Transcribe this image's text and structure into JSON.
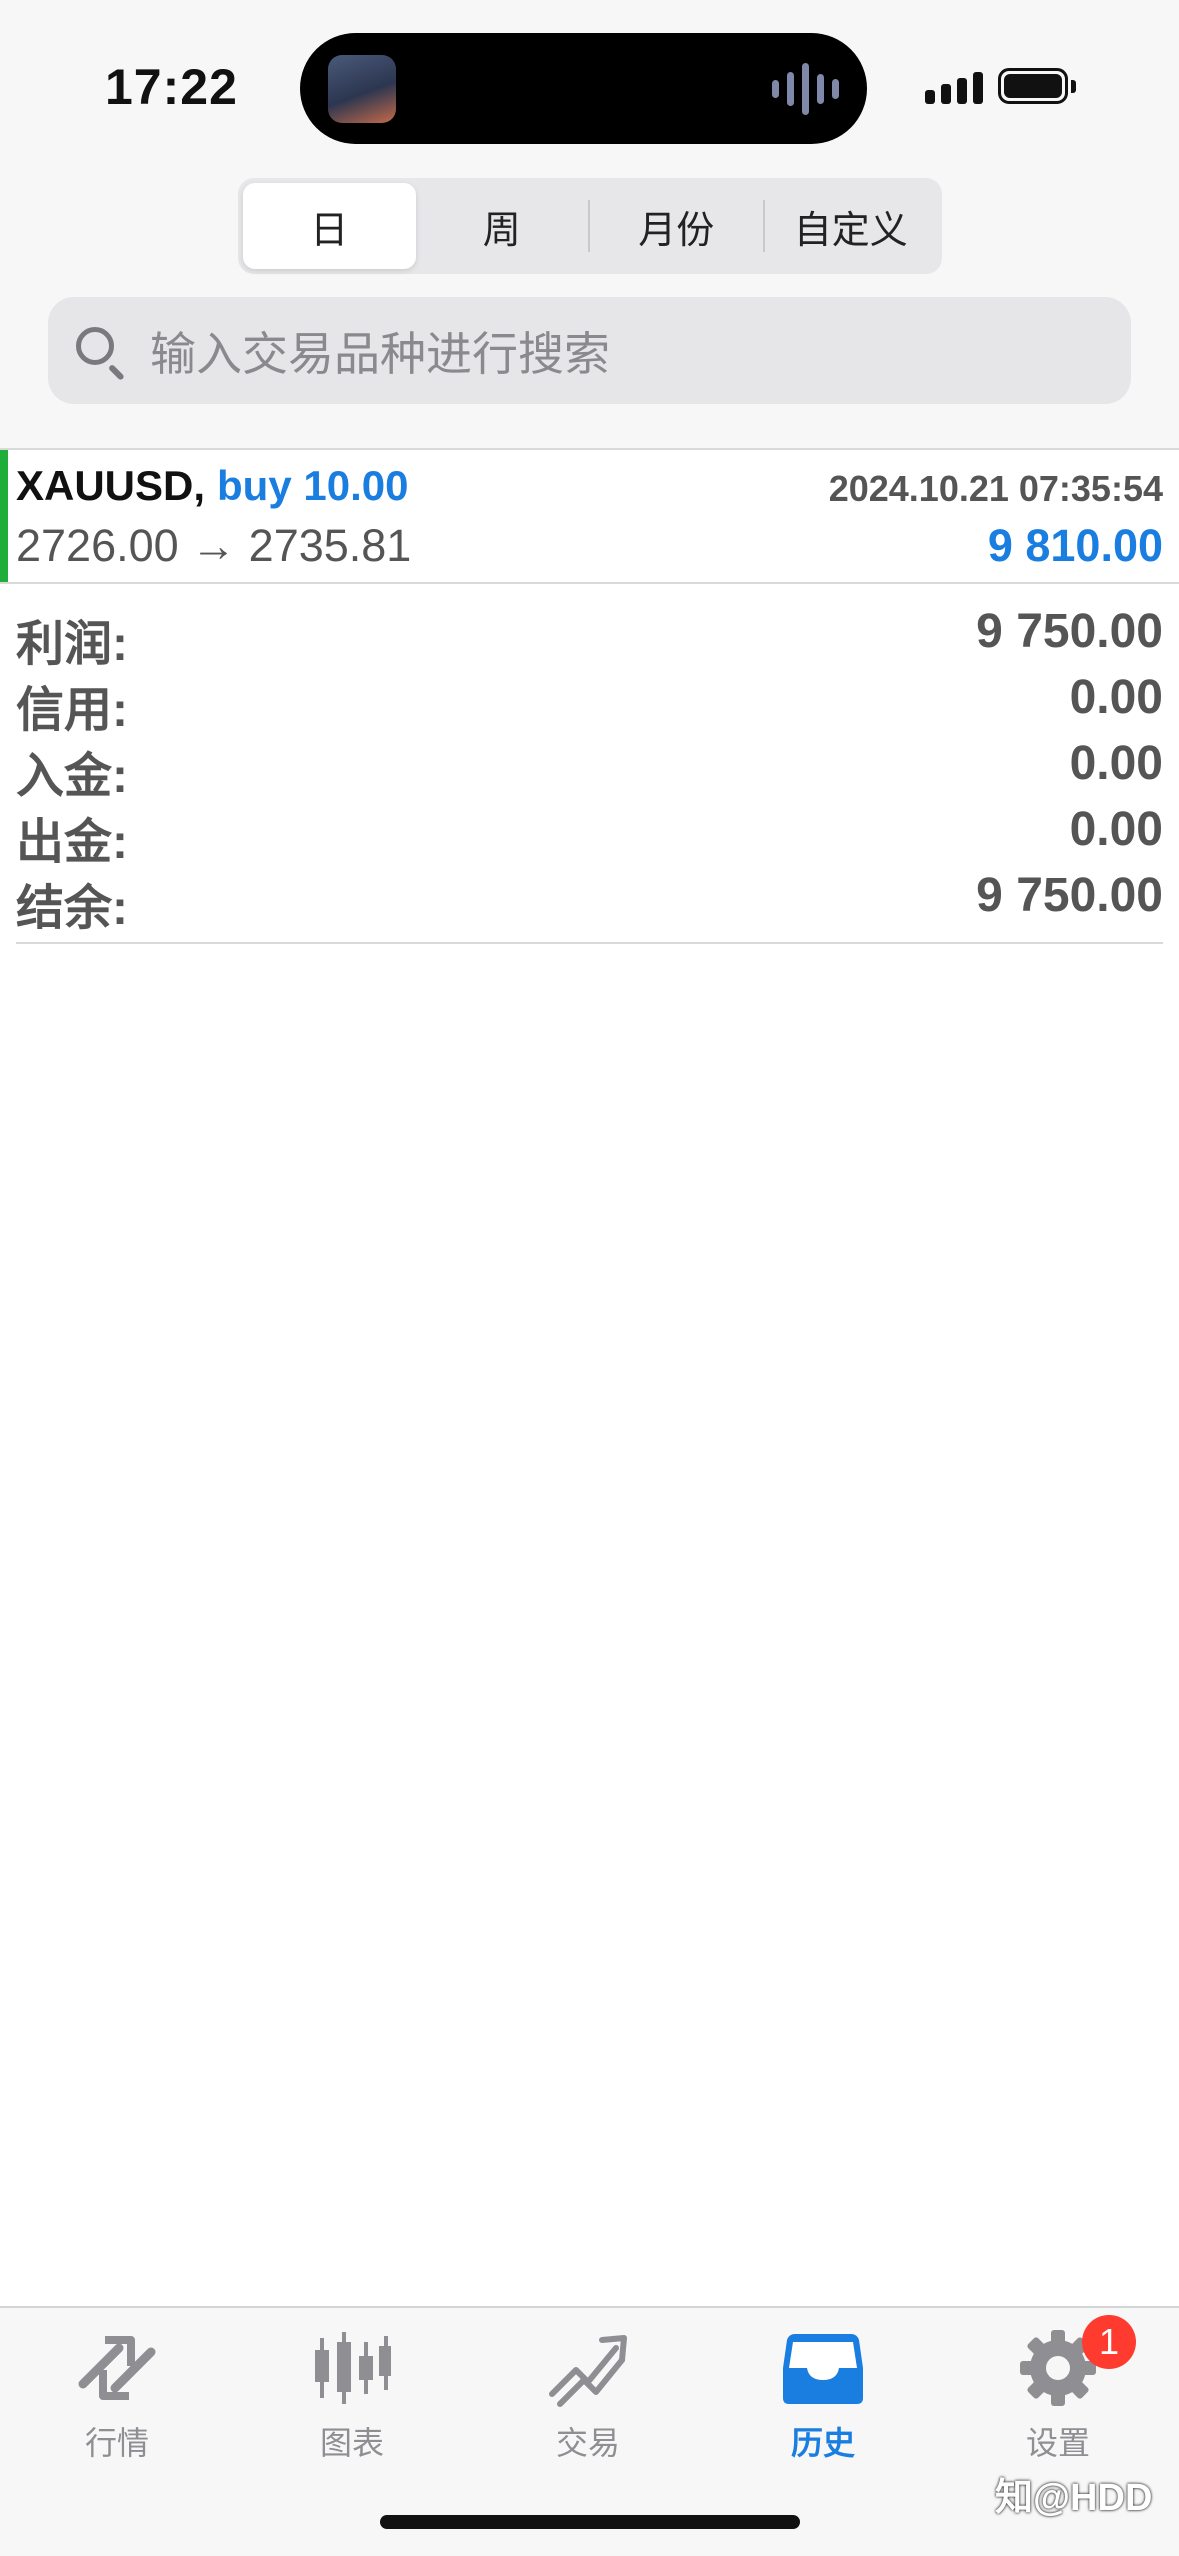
{
  "status_bar": {
    "time": "17:22"
  },
  "period_tabs": [
    {
      "label": "日",
      "active": true
    },
    {
      "label": "周",
      "active": false
    },
    {
      "label": "月份",
      "active": false
    },
    {
      "label": "自定义",
      "active": false
    }
  ],
  "search": {
    "placeholder": "输入交易品种进行搜索",
    "icon": "search-icon"
  },
  "trade": {
    "symbol": "XAUUSD",
    "separator": ",",
    "side": "buy 10.00",
    "datetime": "2024.10.21 07:35:54",
    "prices": "2726.00 → 2735.81",
    "profit": "9 810.00",
    "accent_color": "#1fae3a",
    "profit_color": "#1a7de0"
  },
  "summary": [
    {
      "label": "利润:",
      "value": "9 750.00"
    },
    {
      "label": "信用:",
      "value": "0.00"
    },
    {
      "label": "入金:",
      "value": "0.00"
    },
    {
      "label": "出金:",
      "value": "0.00"
    },
    {
      "label": "结余:",
      "value": "9 750.00"
    }
  ],
  "tabbar": {
    "items": [
      {
        "label": "行情",
        "icon": "quotes-icon",
        "active": false
      },
      {
        "label": "图表",
        "icon": "candlestick-chart-icon",
        "active": false
      },
      {
        "label": "交易",
        "icon": "trade-trend-icon",
        "active": false
      },
      {
        "label": "历史",
        "icon": "history-inbox-icon",
        "active": true
      },
      {
        "label": "设置",
        "icon": "gear-icon",
        "active": false
      }
    ],
    "badge": "1",
    "active_color": "#1a7de0"
  },
  "watermark": "知@HDD"
}
